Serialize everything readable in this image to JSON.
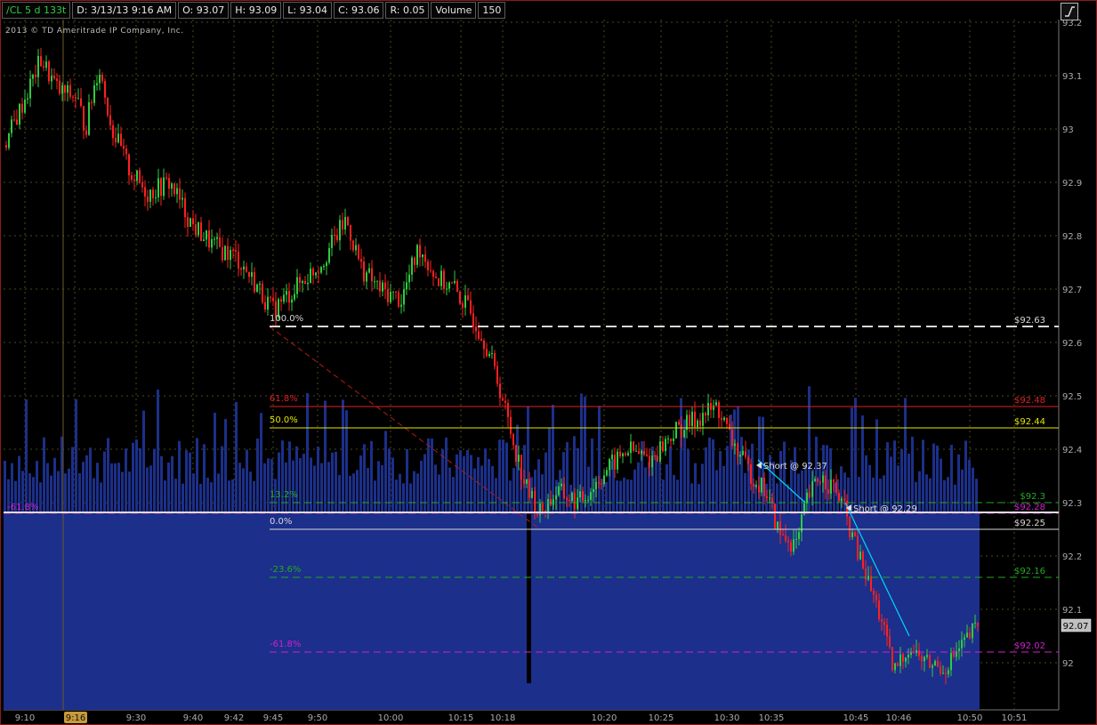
{
  "header": {
    "symbol": "/CL 5 d 133t",
    "date_time": "D: 3/13/13 9:16 AM",
    "open": "O: 93.07",
    "high": "H: 93.09",
    "low": "L: 93.04",
    "close": "C: 93.06",
    "range": "R: 0.05",
    "volume_label": "Volume",
    "volume_value": "150"
  },
  "copyright": "2013 © TD Ameritrade IP Company, Inc.",
  "chart_data": {
    "type": "candlestick",
    "y_ticks": [
      "93.2",
      "93.1",
      "93",
      "92.9",
      "92.8",
      "92.7",
      "92.6",
      "92.5",
      "92.4",
      "92.3",
      "92.2",
      "92.1",
      "92"
    ],
    "ylim": [
      91.91,
      93.21
    ],
    "x_ticks": [
      "9:10",
      "9:16",
      "9:30",
      "9:40",
      "9:42",
      "9:45",
      "9:50",
      "10:00",
      "10:15",
      "10:18",
      "10:20",
      "10:25",
      "10:30",
      "10:35",
      "10:45",
      "10:46",
      "10:50",
      "10:51"
    ],
    "crosshair_time": "9:16",
    "last_price": "92.07",
    "fib_levels": [
      {
        "label": "100.0%",
        "price": 92.63,
        "price_label": "$92.63",
        "color": "#d8d8d8",
        "style": "dashed"
      },
      {
        "label": "61.8%",
        "price": 92.48,
        "price_label": "$92.48",
        "color": "#e02020",
        "style": "solid"
      },
      {
        "label": "50.0%",
        "price": 92.44,
        "price_label": "$92.44",
        "color": "#e6e600",
        "style": "solid"
      },
      {
        "label": "13.2%",
        "price": 92.3,
        "price_label": "$92.3",
        "color": "#22aa22",
        "style": "dashed"
      },
      {
        "label": "-61.8%",
        "price": 92.28,
        "price_label": "$92.28",
        "color": "#d21fd2",
        "style": "dashed"
      },
      {
        "label": "0.0%",
        "price": 92.25,
        "price_label": "$92.25",
        "color": "#d8d8d8",
        "style": "solid"
      },
      {
        "label": "-23.6%",
        "price": 92.16,
        "price_label": "$92.16",
        "color": "#22aa22",
        "style": "dashed"
      },
      {
        "label": "-61.8%",
        "price": 92.02,
        "price_label": "$92.02",
        "color": "#d21fd2",
        "style": "dashed"
      }
    ],
    "annotations": [
      {
        "text": "Short @ 92.37"
      },
      {
        "text": "Short @ 92.29"
      }
    ],
    "colors": {
      "up": "#2ecc40",
      "down": "#ff2020",
      "volume": "#1c2f8a",
      "grid": "#5a5a22"
    }
  }
}
